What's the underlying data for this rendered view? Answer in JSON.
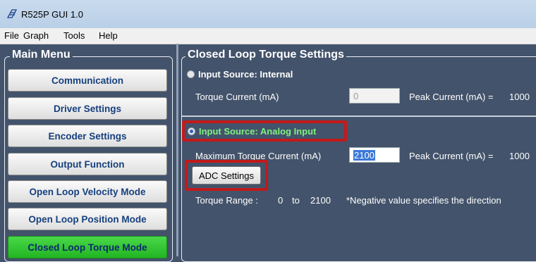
{
  "window": {
    "title": "R525P GUI 1.0"
  },
  "menubar": [
    "File",
    "Graph",
    "Tools",
    "Help"
  ],
  "main_menu": {
    "title": "Main Menu",
    "items": [
      "Communication",
      "Driver Settings",
      "Encoder Settings",
      "Output Function",
      "Open Loop Velocity Mode",
      "Open Loop Position Mode",
      "Closed Loop Torque Mode"
    ],
    "active_index": 6
  },
  "settings": {
    "title": "Closed Loop Torque Settings",
    "internal": {
      "radio_label": "Input Source: Internal",
      "selected": false,
      "torque_label": "Torque Current (mA)",
      "torque_value": "0",
      "peak_label": "Peak Current (mA) =",
      "peak_value": "1000"
    },
    "analog": {
      "radio_label": "Input Source: Analog Input",
      "selected": true,
      "max_label": "Maximum Torque Current (mA)",
      "max_value": "2100",
      "peak_label": "Peak Current (mA) =",
      "peak_value": "1000",
      "adc_button": "ADC Settings",
      "range_label": "Torque Range :",
      "range_min": "0",
      "range_to": "to",
      "range_max": "2100",
      "note": "*Negative value specifies the direction"
    }
  },
  "colors": {
    "panel_bg": "#43536b",
    "active_item": "#2ec42e",
    "highlight_box": "#c21a1a",
    "analog_label": "#7ff07f"
  }
}
